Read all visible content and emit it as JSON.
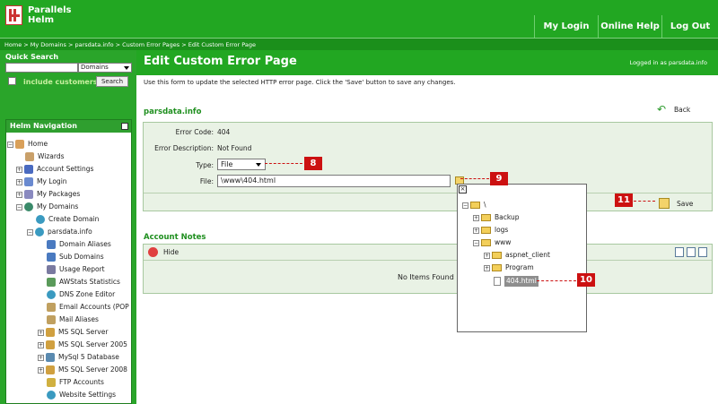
{
  "header": {
    "brand_line1": "Parallels",
    "brand_line2": "Helm",
    "nav": [
      "My Login",
      "Online Help",
      "Log Out"
    ]
  },
  "breadcrumb": "Home > My Domains > parsdata.info > Custom Error Pages > Edit Custom Error Page",
  "quick_search": {
    "title": "Quick Search",
    "input_value": "",
    "select_value": "Domains",
    "include_label": "include customers.",
    "button": "Search"
  },
  "helm_nav": {
    "title": "Helm Navigation",
    "items": [
      "Home",
      "Wizards",
      "Account Settings",
      "My Login",
      "My Packages",
      "My Domains",
      "Create Domain",
      "parsdata.info",
      "Domain Aliases",
      "Sub Domains",
      "Usage Report",
      "AWStats Statistics",
      "DNS Zone Editor",
      "Email Accounts (POP",
      "Mail Aliases",
      "MS SQL Server",
      "MS SQL Server 2005",
      "MySql 5 Database",
      "MS SQL Server 2008",
      "FTP Accounts",
      "Website Settings"
    ]
  },
  "page": {
    "title": "Edit Custom Error Page",
    "logged_in": "Logged in as parsdata.info",
    "intro": "Use this form to update the selected HTTP error page. Click the 'Save' button to save any changes.",
    "domain": "parsdata.info",
    "back": "Back",
    "save": "Save"
  },
  "form": {
    "error_code_label": "Error Code:",
    "error_code_value": "404",
    "error_desc_label": "Error Description:",
    "error_desc_value": "Not Found",
    "type_label": "Type:",
    "type_value": "File",
    "file_label": "File:",
    "file_value": "\\www\\404.html"
  },
  "notes": {
    "title": "Account Notes",
    "hide": "Hide",
    "empty": "No Items Found"
  },
  "file_tree": {
    "root": "\\",
    "items": [
      "Backup",
      "logs",
      "www",
      "aspnet_client",
      "Program",
      "404.html"
    ]
  },
  "callouts": [
    "8",
    "9",
    "10",
    "11"
  ],
  "colors": {
    "brand_green": "#22a722",
    "callout_red": "#cc1111"
  }
}
